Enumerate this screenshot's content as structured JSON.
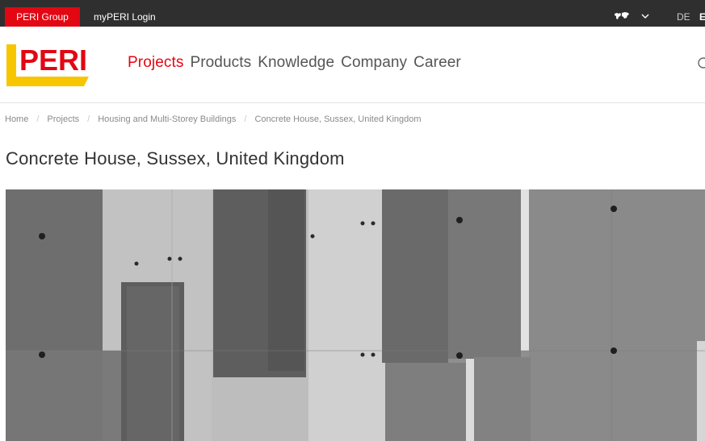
{
  "topbar": {
    "group_link": "PERI Group",
    "login_link": "myPERI Login",
    "lang_de": "DE",
    "lang_en": "E",
    "icons": {
      "region": "world-map-icon",
      "dropdown": "chevron-down-icon"
    }
  },
  "header": {
    "logo_text": "PERI",
    "nav": [
      "Projects",
      "Products",
      "Knowledge",
      "Company",
      "Career"
    ],
    "active_nav": "Projects"
  },
  "breadcrumb": [
    "Home",
    "Projects",
    "Housing and Multi-Storey Buildings",
    "Concrete House, Sussex, United Kingdom"
  ],
  "page": {
    "title": "Concrete House, Sussex, United Kingdom"
  },
  "colors": {
    "brand_red": "#e30613",
    "brand_yellow": "#f7c600",
    "topbar_bg": "#2f2f2f"
  }
}
